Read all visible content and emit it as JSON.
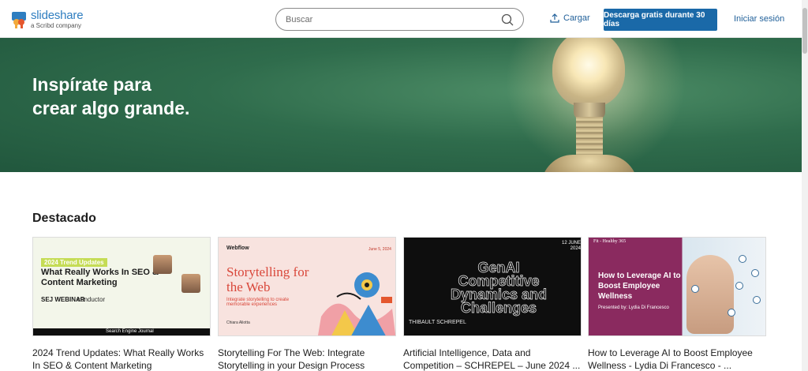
{
  "header": {
    "logo_name": "slideshare",
    "logo_sub": "a Scribd company",
    "search_placeholder": "Buscar",
    "upload_label": "Cargar",
    "cta_label": "Descarga gratis durante 30 días",
    "signin_label": "Iniciar sesión"
  },
  "hero": {
    "title_line1": "Inspírate para",
    "title_line2": "crear algo grande."
  },
  "featured": {
    "title": "Destacado",
    "cards": [
      {
        "title": "2024 Trend Updates: What Really Works In SEO & Content Marketing",
        "thumb": {
          "pill": "2024 Trend Updates",
          "heading": "What Really Works In SEO & Content Marketing",
          "brand": "SEJ WEBINAR",
          "partner": "conductor",
          "footer": "Search Engine Journal"
        }
      },
      {
        "title": "Storytelling For The Web: Integrate Storytelling in your Design Process",
        "thumb": {
          "brand": "Webflow",
          "date": "June 5, 2024",
          "heading": "Storytelling for the Web",
          "sub": "Integrate storytelling to create memorable experiences",
          "by": "Chiara Aliotta"
        }
      },
      {
        "title": "Artificial Intelligence, Data and Competition – SCHREPEL – June 2024 ...",
        "thumb": {
          "date": "12 JUNE 2024",
          "heading": "GenAI Competitive Dynamics and Challenges",
          "author": "THIBAULT SCHREPEL"
        }
      },
      {
        "title": "How to Leverage AI to Boost Employee Wellness - Lydia Di Francesco - ...",
        "thumb": {
          "badge": "Fit - Healthy 365",
          "heading": "How to Leverage AI to Boost Employee Wellness",
          "presenter": "Presented by: Lydia Di Francesco"
        }
      }
    ]
  },
  "colors": {
    "brand_blue": "#1a69a8",
    "hero_green": "#2f6c4c"
  }
}
